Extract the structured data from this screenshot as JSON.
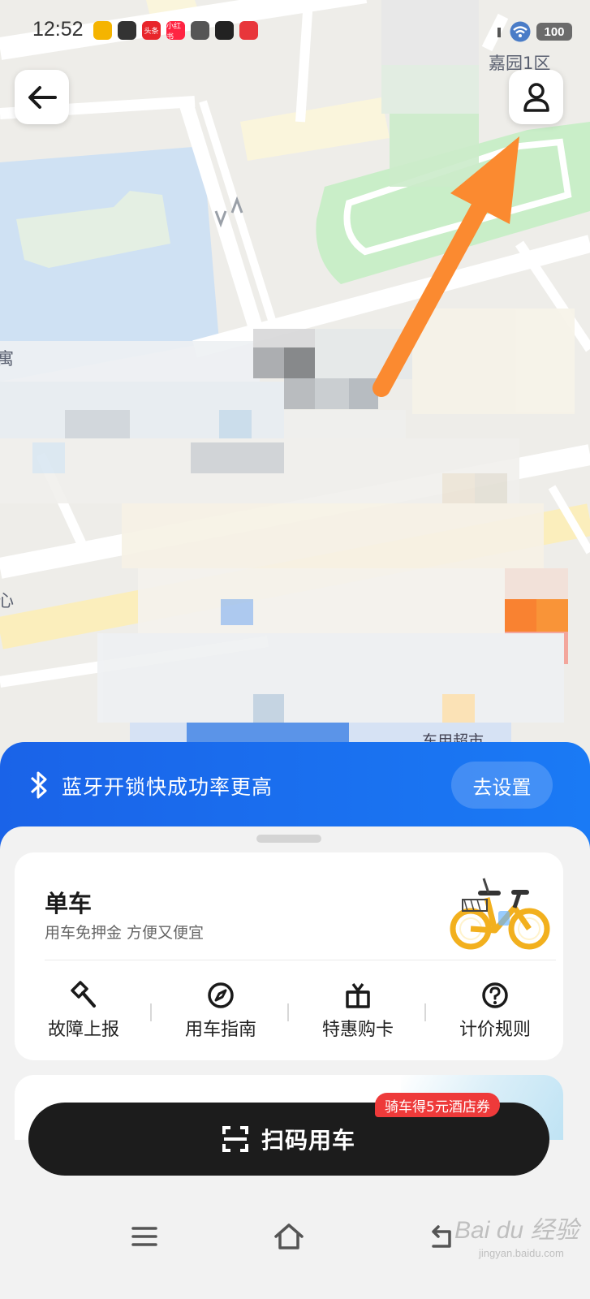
{
  "status_bar": {
    "time": "12:52",
    "battery": "100",
    "app_icons": [
      {
        "name": "weibo-icon",
        "label": "",
        "color": "#f5b400"
      },
      {
        "name": "compass-app-icon",
        "label": "",
        "color": "#333333"
      },
      {
        "name": "toutiao-icon",
        "label": "头条",
        "color": "#e8262b"
      },
      {
        "name": "xiaohongshu-icon",
        "label": "小红书",
        "color": "#ff2442"
      },
      {
        "name": "ninja-app-icon",
        "label": "",
        "color": "#555555"
      },
      {
        "name": "tiktok-icon",
        "label": "",
        "color": "#222222"
      },
      {
        "name": "heart-app-icon",
        "label": "",
        "color": "#e8363b"
      }
    ]
  },
  "map": {
    "labels": {
      "district": "嘉园1区",
      "edge_left_1": "寓",
      "edge_left_2": "心",
      "partial_bottom": "东用超市"
    }
  },
  "banner": {
    "text": "蓝牙开锁快成功率更高",
    "button": "去设置"
  },
  "bike_card": {
    "title": "单车",
    "subtitle": "用车免押金 方便又便宜",
    "functions": [
      {
        "label": "故障上报",
        "icon": "hammer-icon"
      },
      {
        "label": "用车指南",
        "icon": "compass-icon"
      },
      {
        "label": "特惠购卡",
        "icon": "gift-icon"
      },
      {
        "label": "计价规则",
        "icon": "question-icon"
      }
    ]
  },
  "scan": {
    "label": "扫码用车",
    "promo": "骑车得5元酒店券"
  },
  "watermark": {
    "brand": "Bai du 经验",
    "url": "jingyan.baidu.com"
  },
  "colors": {
    "accent_blue": "#1a6ef0",
    "arrow_orange": "#fb8a30",
    "promo_red": "#ee3a3a",
    "bike_yellow": "#f2b01e"
  }
}
